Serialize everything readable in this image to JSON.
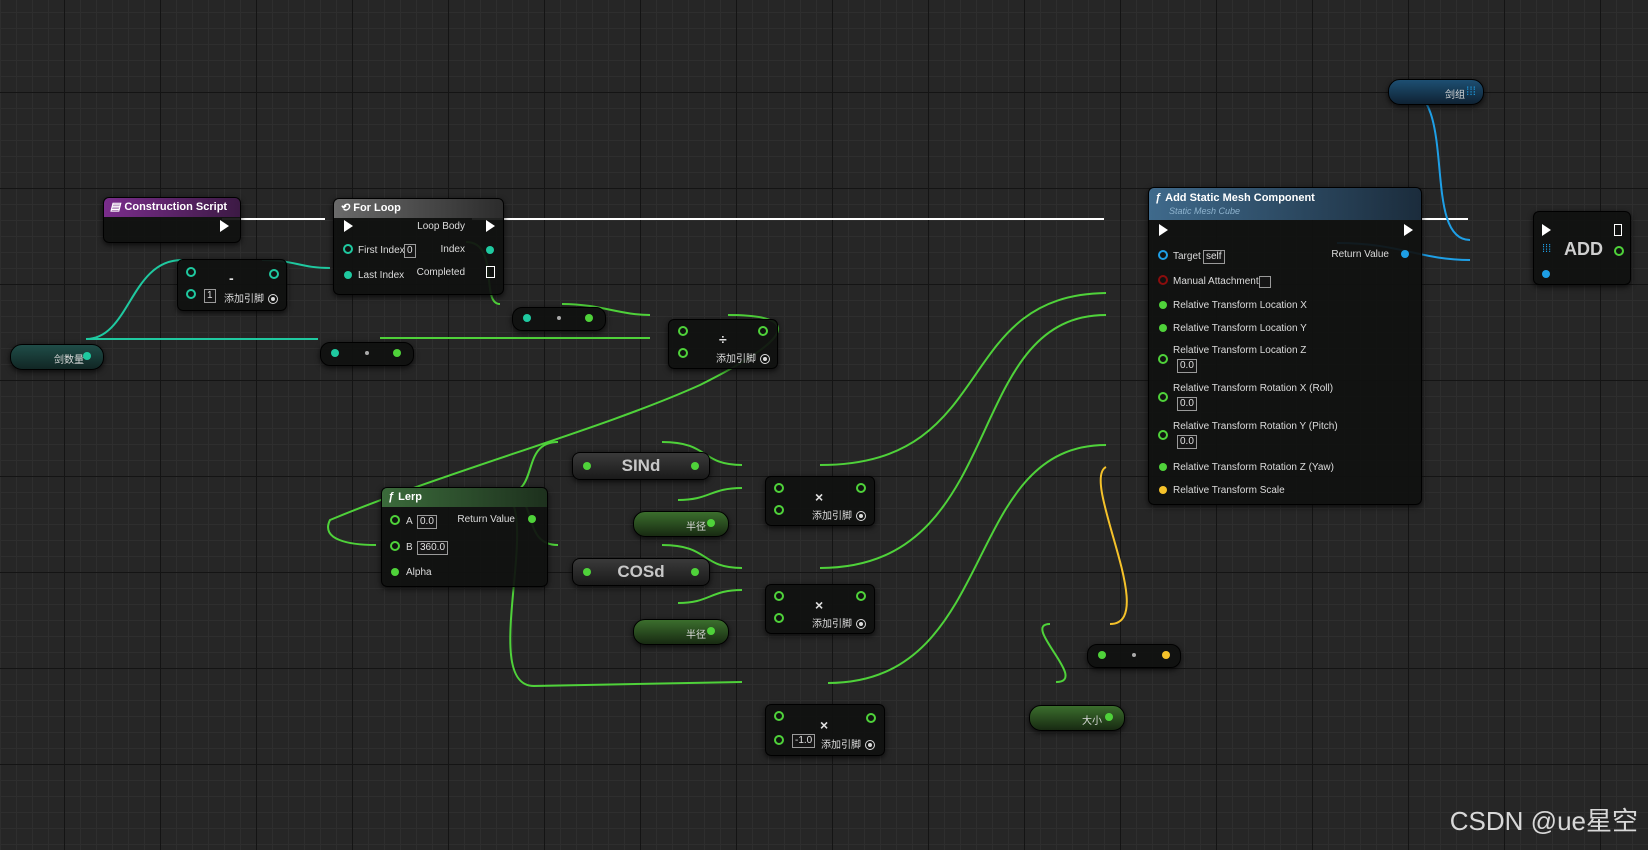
{
  "construction_script": {
    "title": "Construction Script"
  },
  "for_loop": {
    "title": "For Loop",
    "first_index_label": "First Index",
    "first_index_value": "0",
    "last_index_label": "Last Index",
    "loop_body_label": "Loop Body",
    "index_label": "Index",
    "completed_label": "Completed"
  },
  "subtract_node": {
    "op": "-",
    "value": "1",
    "add_pin": "添加引脚"
  },
  "sword_count_var": {
    "label": "剑数量"
  },
  "divide_node": {
    "op": "÷",
    "add_pin": "添加引脚"
  },
  "lerp": {
    "title": "Lerp",
    "a_label": "A",
    "a_value": "0.0",
    "b_label": "B",
    "b_value": "360.0",
    "alpha_label": "Alpha",
    "return_label": "Return Value"
  },
  "sind": {
    "label": "SINd"
  },
  "cosd": {
    "label": "COSd"
  },
  "multiply_sin": {
    "op": "×",
    "add_pin": "添加引脚"
  },
  "multiply_cos": {
    "op": "×",
    "add_pin": "添加引脚"
  },
  "multiply_neg": {
    "op": "×",
    "value": "-1.0",
    "add_pin": "添加引脚"
  },
  "radius_var_1": {
    "label": "半径"
  },
  "radius_var_2": {
    "label": "半径"
  },
  "size_var": {
    "label": "大小"
  },
  "sword_array_var": {
    "label": "剑组"
  },
  "add_static_mesh": {
    "title": "Add Static Mesh Component",
    "subtitle": "Static Mesh Cube",
    "target_label": "Target",
    "target_value": "self",
    "manual_attachment_label": "Manual Attachment",
    "loc_x_label": "Relative Transform Location X",
    "loc_y_label": "Relative Transform Location Y",
    "loc_z_label": "Relative Transform Location Z",
    "loc_z_value": "0.0",
    "rot_x_label": "Relative Transform Rotation X (Roll)",
    "rot_x_value": "0.0",
    "rot_y_label": "Relative Transform Rotation Y (Pitch)",
    "rot_y_value": "0.0",
    "rot_z_label": "Relative Transform Rotation Z (Yaw)",
    "scale_label": "Relative Transform Scale",
    "return_label": "Return Value"
  },
  "array_add": {
    "label": "ADD"
  },
  "watermark": {
    "text": "CSDN @ue星空"
  },
  "colors": {
    "exec": "#ffffff",
    "int_pin": "#1fc9a0",
    "float_pin": "#4fd23a",
    "object_pin": "#1e9fe6",
    "vector_pin": "#f5c22a",
    "bool_pin": "#8b0d0d"
  }
}
